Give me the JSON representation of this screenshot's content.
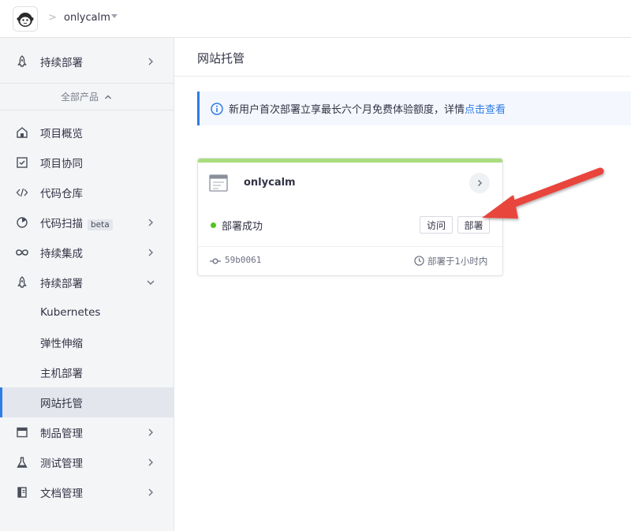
{
  "topbar": {
    "logo_icon": "monkey-avatar-icon",
    "team_name": "onlycalm"
  },
  "sidebar": {
    "pinned": {
      "label": "持续部署",
      "icon": "rocket-icon"
    },
    "all_products_label": "全部产品",
    "items": [
      {
        "label": "项目概览",
        "icon": "home-icon"
      },
      {
        "label": "项目协同",
        "icon": "checkbox-icon"
      },
      {
        "label": "代码仓库",
        "icon": "code-icon"
      },
      {
        "label": "代码扫描",
        "icon": "scan-icon",
        "badge": "beta"
      },
      {
        "label": "持续集成",
        "icon": "infinity-icon"
      },
      {
        "label": "持续部署",
        "icon": "rocket-icon"
      },
      {
        "label": "Kubernetes"
      },
      {
        "label": "弹性伸缩"
      },
      {
        "label": "主机部署"
      },
      {
        "label": "网站托管"
      },
      {
        "label": "制品管理",
        "icon": "package-icon"
      },
      {
        "label": "测试管理",
        "icon": "flask-icon"
      },
      {
        "label": "文档管理",
        "icon": "document-icon"
      }
    ],
    "active": "网站托管"
  },
  "main": {
    "title": "网站托管",
    "notice": {
      "text": "新用户首次部署立享最长六个月免费体验额度，详情",
      "link": "点击查看"
    },
    "card": {
      "site_name": "onlycalm",
      "status": "部署成功",
      "visit_label": "访问",
      "deploy_label": "部署",
      "commit": "59b0061",
      "time": "部署于1小时内"
    }
  },
  "colors": {
    "accent": "#2e7ce8",
    "success": "#52c41a",
    "card_top": "#a9dd7d",
    "arrow": "#e8453c"
  }
}
